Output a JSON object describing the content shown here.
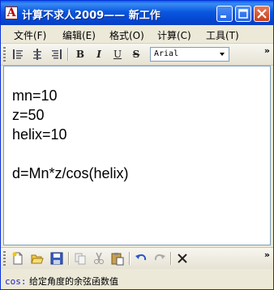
{
  "window": {
    "title": "计算不求人2009—— 新工作",
    "app_icon_glyph": "A"
  },
  "titlebar_buttons": [
    "minimize-icon",
    "maximize-icon",
    "close-icon"
  ],
  "menu": {
    "items": [
      "文件(F)",
      "编辑(E)",
      "格式(O)",
      "计算(C)",
      "工具(T)"
    ]
  },
  "format_toolbar": {
    "align_buttons": [
      "align-left-icon",
      "align-center-icon",
      "align-right-icon"
    ],
    "bold_label": "B",
    "italic_label": "I",
    "underline_label": "U",
    "strike_label": "S",
    "font_value": "Arial",
    "overflow_label": "»"
  },
  "editor": {
    "lines": [
      "mn=10",
      "z=50",
      "helix=10",
      "",
      "d=Mn*z/cos(helix)"
    ]
  },
  "bottom_toolbar": {
    "buttons": [
      "new-icon",
      "open-icon",
      "save-icon",
      "copy-icon",
      "cut-icon",
      "paste-icon",
      "undo-icon",
      "redo-icon",
      "clear-icon"
    ],
    "overflow_label": "»"
  },
  "status": {
    "keyword": "cos:",
    "description": " 给定角度的余弦函数值"
  },
  "colors": {
    "title_bar": "#0a58e0",
    "close_button": "#c3401c",
    "window_bg": "#ece9d8",
    "status_keyword": "#1a1ad0"
  }
}
